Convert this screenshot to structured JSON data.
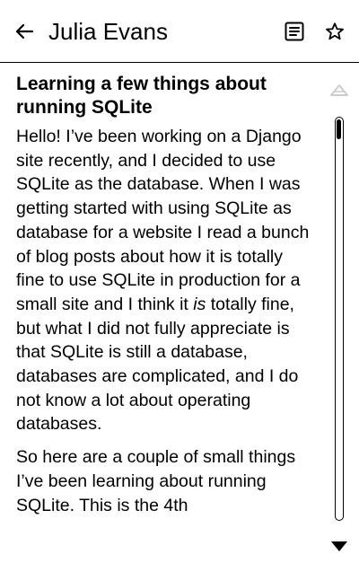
{
  "header": {
    "title": "Julia Evans",
    "back_icon": "arrow-left-icon",
    "toc_icon": "table-of-contents-icon",
    "star_icon": "star-outline-icon"
  },
  "article": {
    "title": "Learning a few things about running SQLite",
    "p1_start": "Hello! I’ve been working on a Django site recently, and I decided to use SQLite as the database. When I was getting started with using SQLite as database for a website I read a bunch of blog posts about how it is totally fine to use SQLite in production for a small site and I think it ",
    "p1_emph": "is",
    "p1_end": " totally fine, but what I did not fully appreciate is that SQLite is still a database, databases are complicated, and I do not know a lot about operating databases.",
    "p2": "So here are a couple of small things I’ve been learning about running SQLite. This is the 4th"
  },
  "scrollbar": {
    "up_icon": "scroll-up-triangle-icon",
    "down_icon": "scroll-down-triangle-icon",
    "position": 0
  },
  "colors": {
    "text": "#000000",
    "background": "#ffffff",
    "disabled": "#cccccc"
  }
}
